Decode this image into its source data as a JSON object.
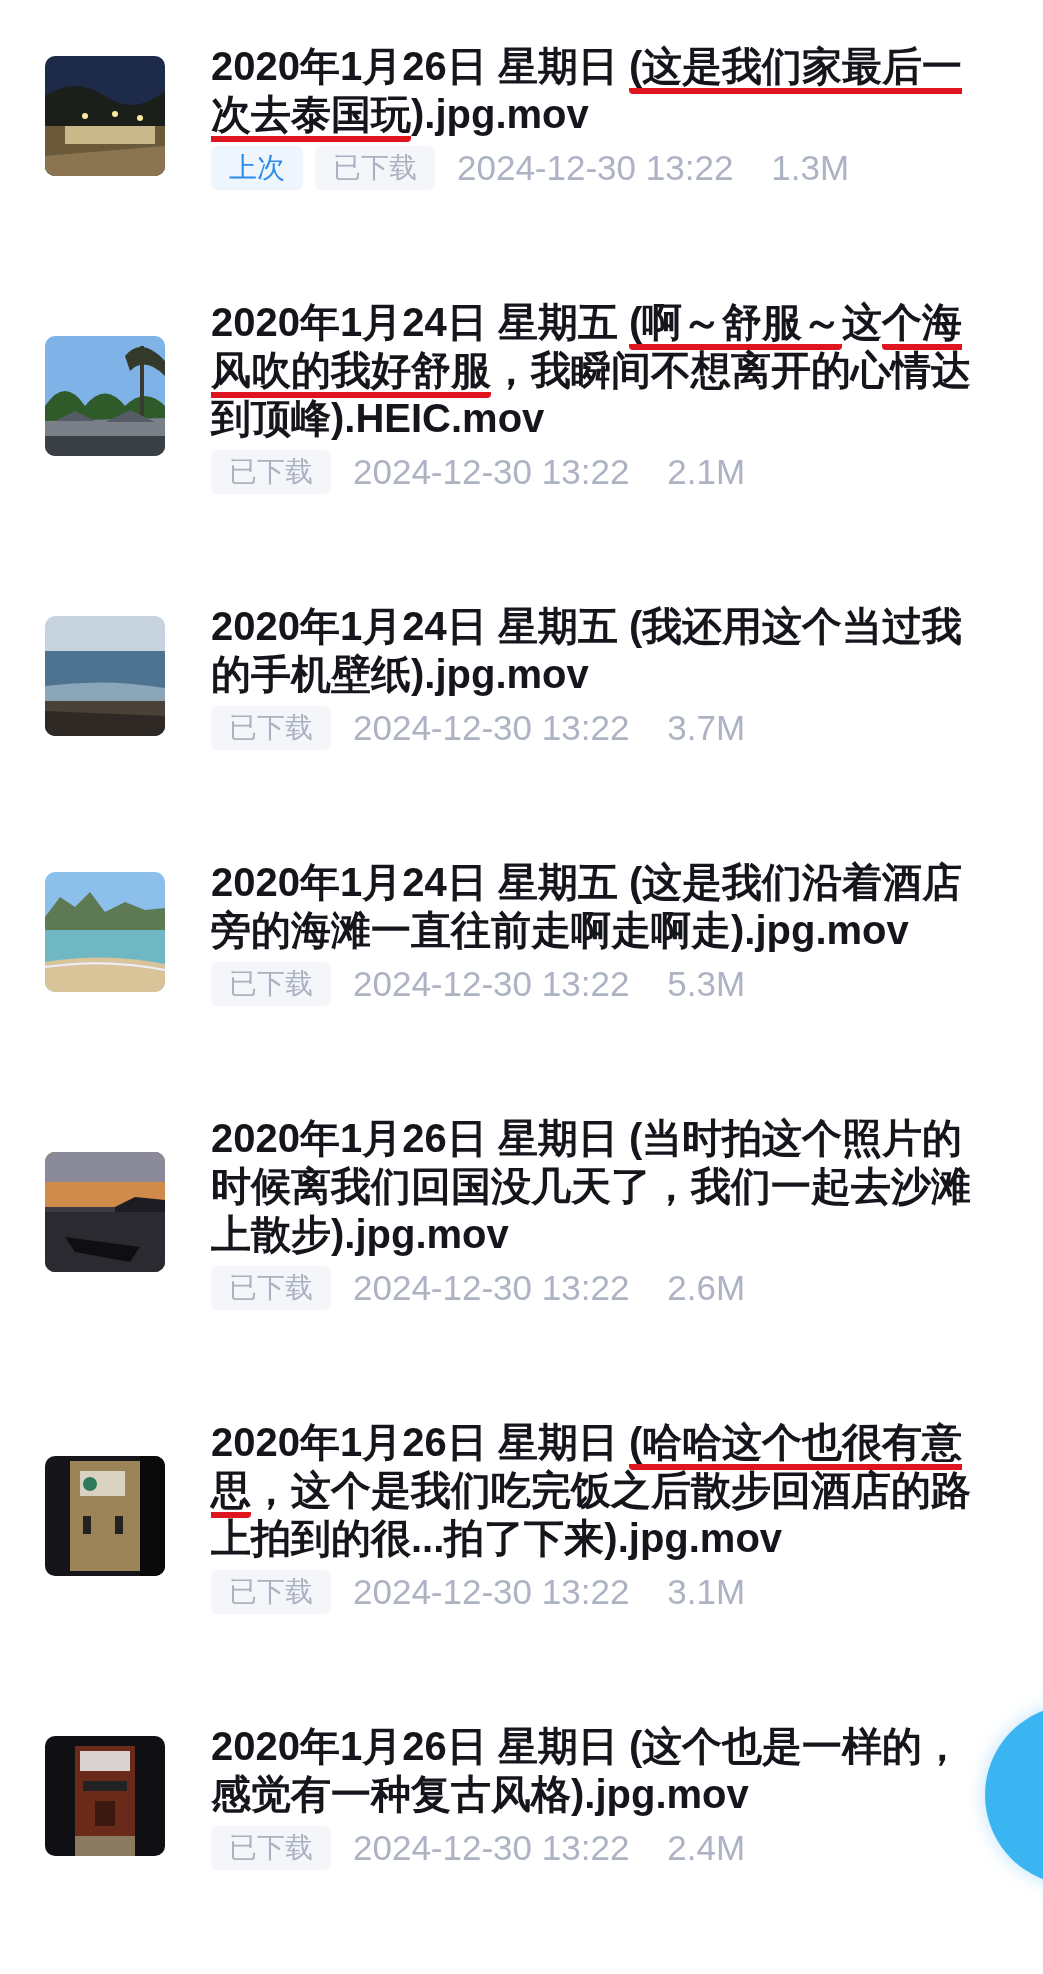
{
  "items": [
    {
      "thumbnail": {
        "kind": "picture"
      },
      "title": [
        {
          "text": "2020年1月26日 星期日 ",
          "marked": false
        },
        {
          "text": "(这是我们家最后一次去泰国玩",
          "marked": true
        },
        {
          "text": ").jpg.mov",
          "marked": false
        }
      ],
      "tags": [
        {
          "label": "上次",
          "kind": "last"
        },
        {
          "label": "已下载",
          "kind": "downloaded"
        }
      ],
      "timestamp": "2024-12-30 13:22",
      "size": "1.3M"
    },
    {
      "thumbnail": {
        "kind": "picture"
      },
      "title": [
        {
          "text": "2020年1月24日 星期五 ",
          "marked": false
        },
        {
          "text": "(啊～舒服～",
          "marked": true
        },
        {
          "text": "这",
          "marked": false
        },
        {
          "text": "个海风吹的我好舒服",
          "marked": true
        },
        {
          "text": "，我瞬间不想离开的心情达到顶峰).HEIC.mov",
          "marked": false
        }
      ],
      "tags": [
        {
          "label": "已下载",
          "kind": "downloaded"
        }
      ],
      "timestamp": "2024-12-30 13:22",
      "size": "2.1M"
    },
    {
      "thumbnail": {
        "kind": "picture"
      },
      "title": [
        {
          "text": "2020年1月24日 星期五 (我还用这个当过我的手机壁纸).jpg.mov",
          "marked": false
        }
      ],
      "tags": [
        {
          "label": "已下载",
          "kind": "downloaded"
        }
      ],
      "timestamp": "2024-12-30 13:22",
      "size": "3.7M"
    },
    {
      "thumbnail": {
        "kind": "picture"
      },
      "title": [
        {
          "text": "2020年1月24日 星期五 (这是我们沿着酒店旁的海滩一直往前走啊走啊走).jpg.mov",
          "marked": false
        }
      ],
      "tags": [
        {
          "label": "已下载",
          "kind": "downloaded"
        }
      ],
      "timestamp": "2024-12-30 13:22",
      "size": "5.3M"
    },
    {
      "thumbnail": {
        "kind": "picture"
      },
      "title": [
        {
          "text": "2020年1月26日 星期日 (当时拍这个照片的时候离我们回国没几天了，我们一起去沙滩上散步).jpg.mov",
          "marked": false
        }
      ],
      "tags": [
        {
          "label": "已下载",
          "kind": "downloaded"
        }
      ],
      "timestamp": "2024-12-30 13:22",
      "size": "2.6M"
    },
    {
      "thumbnail": {
        "kind": "picture"
      },
      "title": [
        {
          "text": "2020年1月26日 星期日 ",
          "marked": false
        },
        {
          "text": "(哈哈这个也很有意思",
          "marked": true
        },
        {
          "text": "，这个是我们吃完饭之后散步回酒店的路上拍到的很...拍了下来).jpg.mov",
          "marked": false
        }
      ],
      "tags": [
        {
          "label": "已下载",
          "kind": "downloaded"
        }
      ],
      "timestamp": "2024-12-30 13:22",
      "size": "3.1M"
    },
    {
      "thumbnail": {
        "kind": "picture"
      },
      "title": [
        {
          "text": "2020年1月26日 星期日 (这个也是一样的，感觉有一种复古风格).jpg.mov",
          "marked": false
        }
      ],
      "tags": [
        {
          "label": "已下载",
          "kind": "downloaded"
        }
      ],
      "timestamp": "2024-12-30 13:22",
      "size": "2.4M"
    }
  ],
  "floating_button": {
    "kind": "round"
  }
}
